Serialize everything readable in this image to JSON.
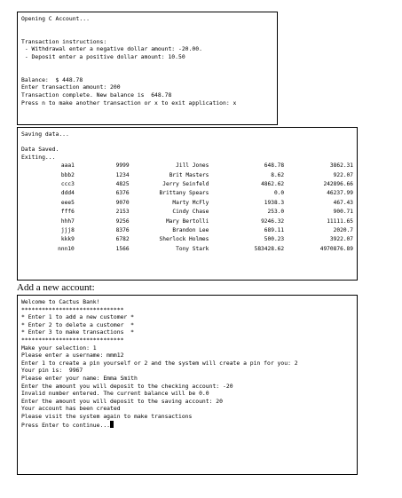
{
  "terminal1": {
    "lines": [
      "Opening C Account...",
      "",
      "",
      "Transaction instructions:",
      " - Withdrawal enter a negative dollar amount: -20.00.",
      " - Deposit enter a positive dollar amount: 10.50",
      "",
      "",
      "Balance:  $ 448.78",
      "Enter transaction amount: 200",
      "Transaction complete. New balance is  648.78",
      "Press n to make another transaction or x to exit application: x"
    ]
  },
  "terminal2": {
    "header_lines": [
      "Saving data...",
      "",
      "Data Saved.",
      "Exiting..."
    ],
    "rows": [
      [
        "aaa1",
        "9999",
        "Jill Jones",
        "648.78",
        "3862.31"
      ],
      [
        "bbb2",
        "1234",
        "Brit Masters",
        "8.62",
        "922.07"
      ],
      [
        "ccc3",
        "4825",
        "Jerry Seinfeld",
        "4862.62",
        "242896.66"
      ],
      [
        "ddd4",
        "6376",
        "Brittany Spears",
        "0.0",
        "46237.99"
      ],
      [
        "eee5",
        "9070",
        "Marty McFly",
        "1938.3",
        "467.43"
      ],
      [
        "fff6",
        "2153",
        "Cindy Chase",
        "253.0",
        "900.71"
      ],
      [
        "hhh7",
        "9256",
        "Mary Bertolli",
        "9246.32",
        "11111.65"
      ],
      [
        "jjj8",
        "8376",
        "Brandon Lee",
        "689.11",
        "2020.7"
      ],
      [
        "kkk9",
        "6782",
        "Sherlock Holmes",
        "500.23",
        "3922.07"
      ],
      [
        "nnn10",
        "1566",
        "Tony Stark",
        "583428.62",
        "4970876.89"
      ]
    ]
  },
  "caption": "Add a new account:",
  "terminal3": {
    "lines": [
      "Welcome to Cactus Bank!",
      "******************************",
      "* Enter 1 to add a new customer *",
      "* Enter 2 to delete a customer  *",
      "* Enter 3 to make transactions  *",
      "******************************",
      "Make your selection: 1",
      "Please enter a username: mmm12",
      "Enter 1 to create a pin yourself or 2 and the system will create a pin for you: 2",
      "Your pin is:  9967",
      "Please enter your name: Emma Smith",
      "Enter the amount you will deposit to the checking account: -20",
      "Invalid number entered. The current balance will be 0.0",
      "Enter the amount you will deposit to the saving account: 20",
      "Your account has been created",
      "Please visit the system again to make transactions"
    ],
    "prompt": "Press Enter to continue..."
  }
}
